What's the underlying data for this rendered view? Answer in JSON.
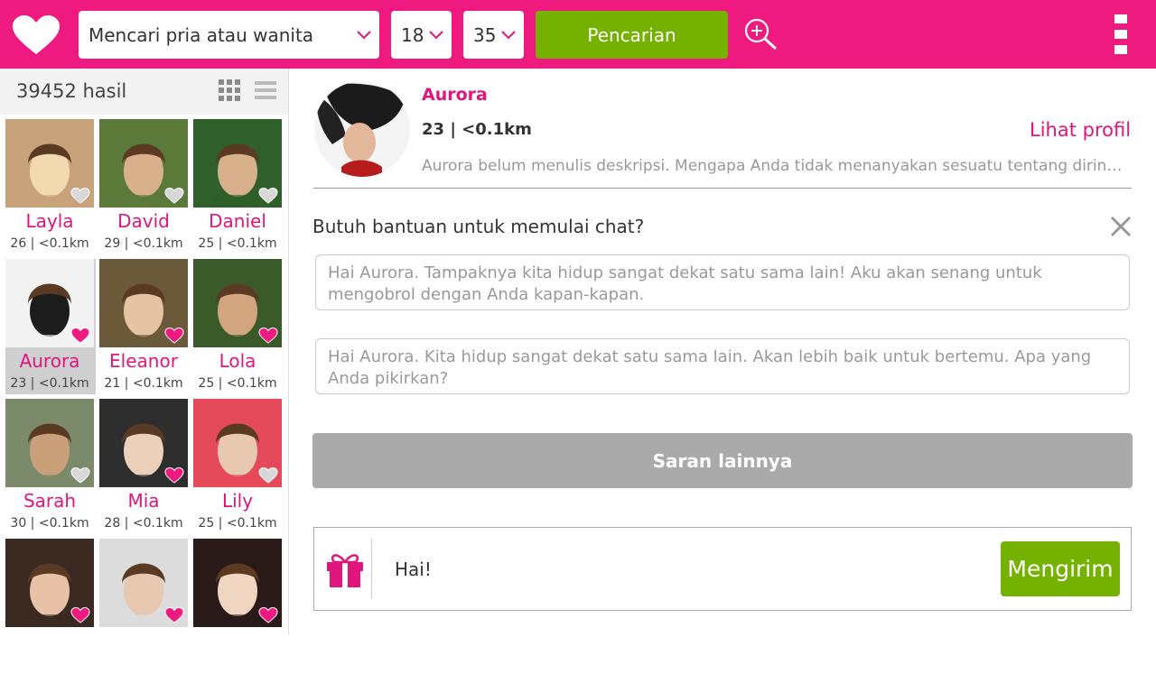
{
  "colors": {
    "brand": "#ee1a7f",
    "accent_text": "#e0157d",
    "action_green": "#75b200",
    "disabled_gray": "#aaaaaa"
  },
  "topbar": {
    "gender_select": "Mencari pria atau wanita",
    "age_min": "18",
    "age_max": "35",
    "search_label": "Pencarian",
    "icons": [
      "heart-logo-icon",
      "chevron-down-icon",
      "search-plus-icon",
      "overflow-menu-icon"
    ]
  },
  "results": {
    "count": "39452 hasil",
    "profiles": [
      {
        "name": "Layla",
        "meta": "26 | <0.1km"
      },
      {
        "name": "David",
        "meta": "29 | <0.1km"
      },
      {
        "name": "Daniel",
        "meta": "25 | <0.1km"
      },
      {
        "name": "Aurora",
        "meta": "23 | <0.1km"
      },
      {
        "name": "Eleanor",
        "meta": "21 | <0.1km"
      },
      {
        "name": "Lola",
        "meta": "25 | <0.1km"
      },
      {
        "name": "Sarah",
        "meta": "30 | <0.1km"
      },
      {
        "name": "Mia",
        "meta": "28 | <0.1km"
      },
      {
        "name": "Lily",
        "meta": "25 | <0.1km"
      },
      {
        "name": "",
        "meta": ""
      },
      {
        "name": "",
        "meta": ""
      },
      {
        "name": "",
        "meta": ""
      }
    ]
  },
  "profile": {
    "name": "Aurora",
    "meta": "23 | <0.1km",
    "view_profile": "Lihat profil",
    "description": "Aurora belum menulis deskripsi. Mengapa Anda tidak menanyakan sesuatu tentang dirinya?"
  },
  "chat": {
    "help_title": "Butuh bantuan untuk memulai chat?",
    "suggestions": [
      "Hai Aurora. Tampaknya kita hidup sangat dekat satu sama lain! Aku akan senang untuk mengobrol dengan Anda kapan-kapan.",
      "Hai Aurora. Kita hidup sangat dekat satu sama lain. Akan lebih baik untuk bertemu. Apa yang Anda pikirkan?"
    ],
    "more_label": "Saran lainnya",
    "message": "Hai!",
    "send_label": "Mengirim"
  }
}
